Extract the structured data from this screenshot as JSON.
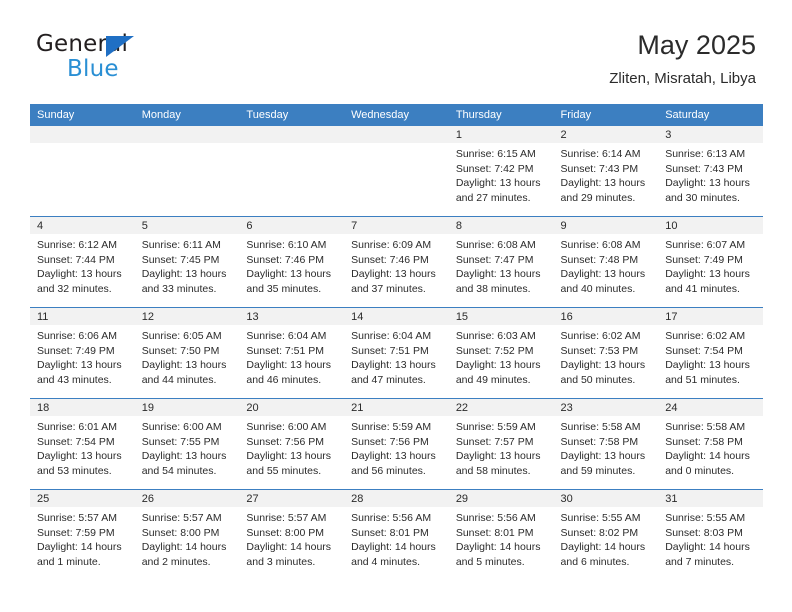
{
  "brand": {
    "name_part1": "General",
    "name_part2": "Blue",
    "accent_color": "#2a8fd4",
    "triangle_color": "#1f6fc4"
  },
  "header": {
    "title": "May 2025",
    "subtitle": "Zliten, Misratah, Libya"
  },
  "calendar": {
    "header_bg": "#3c7fc1",
    "daynum_bg": "#f2f2f2",
    "weekdays": [
      "Sunday",
      "Monday",
      "Tuesday",
      "Wednesday",
      "Thursday",
      "Friday",
      "Saturday"
    ],
    "weeks": [
      [
        {
          "day": "",
          "empty": true
        },
        {
          "day": "",
          "empty": true
        },
        {
          "day": "",
          "empty": true
        },
        {
          "day": "",
          "empty": true
        },
        {
          "day": "1",
          "sunrise": "Sunrise: 6:15 AM",
          "sunset": "Sunset: 7:42 PM",
          "daylight1": "Daylight: 13 hours",
          "daylight2": "and 27 minutes."
        },
        {
          "day": "2",
          "sunrise": "Sunrise: 6:14 AM",
          "sunset": "Sunset: 7:43 PM",
          "daylight1": "Daylight: 13 hours",
          "daylight2": "and 29 minutes."
        },
        {
          "day": "3",
          "sunrise": "Sunrise: 6:13 AM",
          "sunset": "Sunset: 7:43 PM",
          "daylight1": "Daylight: 13 hours",
          "daylight2": "and 30 minutes."
        }
      ],
      [
        {
          "day": "4",
          "sunrise": "Sunrise: 6:12 AM",
          "sunset": "Sunset: 7:44 PM",
          "daylight1": "Daylight: 13 hours",
          "daylight2": "and 32 minutes."
        },
        {
          "day": "5",
          "sunrise": "Sunrise: 6:11 AM",
          "sunset": "Sunset: 7:45 PM",
          "daylight1": "Daylight: 13 hours",
          "daylight2": "and 33 minutes."
        },
        {
          "day": "6",
          "sunrise": "Sunrise: 6:10 AM",
          "sunset": "Sunset: 7:46 PM",
          "daylight1": "Daylight: 13 hours",
          "daylight2": "and 35 minutes."
        },
        {
          "day": "7",
          "sunrise": "Sunrise: 6:09 AM",
          "sunset": "Sunset: 7:46 PM",
          "daylight1": "Daylight: 13 hours",
          "daylight2": "and 37 minutes."
        },
        {
          "day": "8",
          "sunrise": "Sunrise: 6:08 AM",
          "sunset": "Sunset: 7:47 PM",
          "daylight1": "Daylight: 13 hours",
          "daylight2": "and 38 minutes."
        },
        {
          "day": "9",
          "sunrise": "Sunrise: 6:08 AM",
          "sunset": "Sunset: 7:48 PM",
          "daylight1": "Daylight: 13 hours",
          "daylight2": "and 40 minutes."
        },
        {
          "day": "10",
          "sunrise": "Sunrise: 6:07 AM",
          "sunset": "Sunset: 7:49 PM",
          "daylight1": "Daylight: 13 hours",
          "daylight2": "and 41 minutes."
        }
      ],
      [
        {
          "day": "11",
          "sunrise": "Sunrise: 6:06 AM",
          "sunset": "Sunset: 7:49 PM",
          "daylight1": "Daylight: 13 hours",
          "daylight2": "and 43 minutes."
        },
        {
          "day": "12",
          "sunrise": "Sunrise: 6:05 AM",
          "sunset": "Sunset: 7:50 PM",
          "daylight1": "Daylight: 13 hours",
          "daylight2": "and 44 minutes."
        },
        {
          "day": "13",
          "sunrise": "Sunrise: 6:04 AM",
          "sunset": "Sunset: 7:51 PM",
          "daylight1": "Daylight: 13 hours",
          "daylight2": "and 46 minutes."
        },
        {
          "day": "14",
          "sunrise": "Sunrise: 6:04 AM",
          "sunset": "Sunset: 7:51 PM",
          "daylight1": "Daylight: 13 hours",
          "daylight2": "and 47 minutes."
        },
        {
          "day": "15",
          "sunrise": "Sunrise: 6:03 AM",
          "sunset": "Sunset: 7:52 PM",
          "daylight1": "Daylight: 13 hours",
          "daylight2": "and 49 minutes."
        },
        {
          "day": "16",
          "sunrise": "Sunrise: 6:02 AM",
          "sunset": "Sunset: 7:53 PM",
          "daylight1": "Daylight: 13 hours",
          "daylight2": "and 50 minutes."
        },
        {
          "day": "17",
          "sunrise": "Sunrise: 6:02 AM",
          "sunset": "Sunset: 7:54 PM",
          "daylight1": "Daylight: 13 hours",
          "daylight2": "and 51 minutes."
        }
      ],
      [
        {
          "day": "18",
          "sunrise": "Sunrise: 6:01 AM",
          "sunset": "Sunset: 7:54 PM",
          "daylight1": "Daylight: 13 hours",
          "daylight2": "and 53 minutes."
        },
        {
          "day": "19",
          "sunrise": "Sunrise: 6:00 AM",
          "sunset": "Sunset: 7:55 PM",
          "daylight1": "Daylight: 13 hours",
          "daylight2": "and 54 minutes."
        },
        {
          "day": "20",
          "sunrise": "Sunrise: 6:00 AM",
          "sunset": "Sunset: 7:56 PM",
          "daylight1": "Daylight: 13 hours",
          "daylight2": "and 55 minutes."
        },
        {
          "day": "21",
          "sunrise": "Sunrise: 5:59 AM",
          "sunset": "Sunset: 7:56 PM",
          "daylight1": "Daylight: 13 hours",
          "daylight2": "and 56 minutes."
        },
        {
          "day": "22",
          "sunrise": "Sunrise: 5:59 AM",
          "sunset": "Sunset: 7:57 PM",
          "daylight1": "Daylight: 13 hours",
          "daylight2": "and 58 minutes."
        },
        {
          "day": "23",
          "sunrise": "Sunrise: 5:58 AM",
          "sunset": "Sunset: 7:58 PM",
          "daylight1": "Daylight: 13 hours",
          "daylight2": "and 59 minutes."
        },
        {
          "day": "24",
          "sunrise": "Sunrise: 5:58 AM",
          "sunset": "Sunset: 7:58 PM",
          "daylight1": "Daylight: 14 hours",
          "daylight2": "and 0 minutes."
        }
      ],
      [
        {
          "day": "25",
          "sunrise": "Sunrise: 5:57 AM",
          "sunset": "Sunset: 7:59 PM",
          "daylight1": "Daylight: 14 hours",
          "daylight2": "and 1 minute."
        },
        {
          "day": "26",
          "sunrise": "Sunrise: 5:57 AM",
          "sunset": "Sunset: 8:00 PM",
          "daylight1": "Daylight: 14 hours",
          "daylight2": "and 2 minutes."
        },
        {
          "day": "27",
          "sunrise": "Sunrise: 5:57 AM",
          "sunset": "Sunset: 8:00 PM",
          "daylight1": "Daylight: 14 hours",
          "daylight2": "and 3 minutes."
        },
        {
          "day": "28",
          "sunrise": "Sunrise: 5:56 AM",
          "sunset": "Sunset: 8:01 PM",
          "daylight1": "Daylight: 14 hours",
          "daylight2": "and 4 minutes."
        },
        {
          "day": "29",
          "sunrise": "Sunrise: 5:56 AM",
          "sunset": "Sunset: 8:01 PM",
          "daylight1": "Daylight: 14 hours",
          "daylight2": "and 5 minutes."
        },
        {
          "day": "30",
          "sunrise": "Sunrise: 5:55 AM",
          "sunset": "Sunset: 8:02 PM",
          "daylight1": "Daylight: 14 hours",
          "daylight2": "and 6 minutes."
        },
        {
          "day": "31",
          "sunrise": "Sunrise: 5:55 AM",
          "sunset": "Sunset: 8:03 PM",
          "daylight1": "Daylight: 14 hours",
          "daylight2": "and 7 minutes."
        }
      ]
    ]
  }
}
